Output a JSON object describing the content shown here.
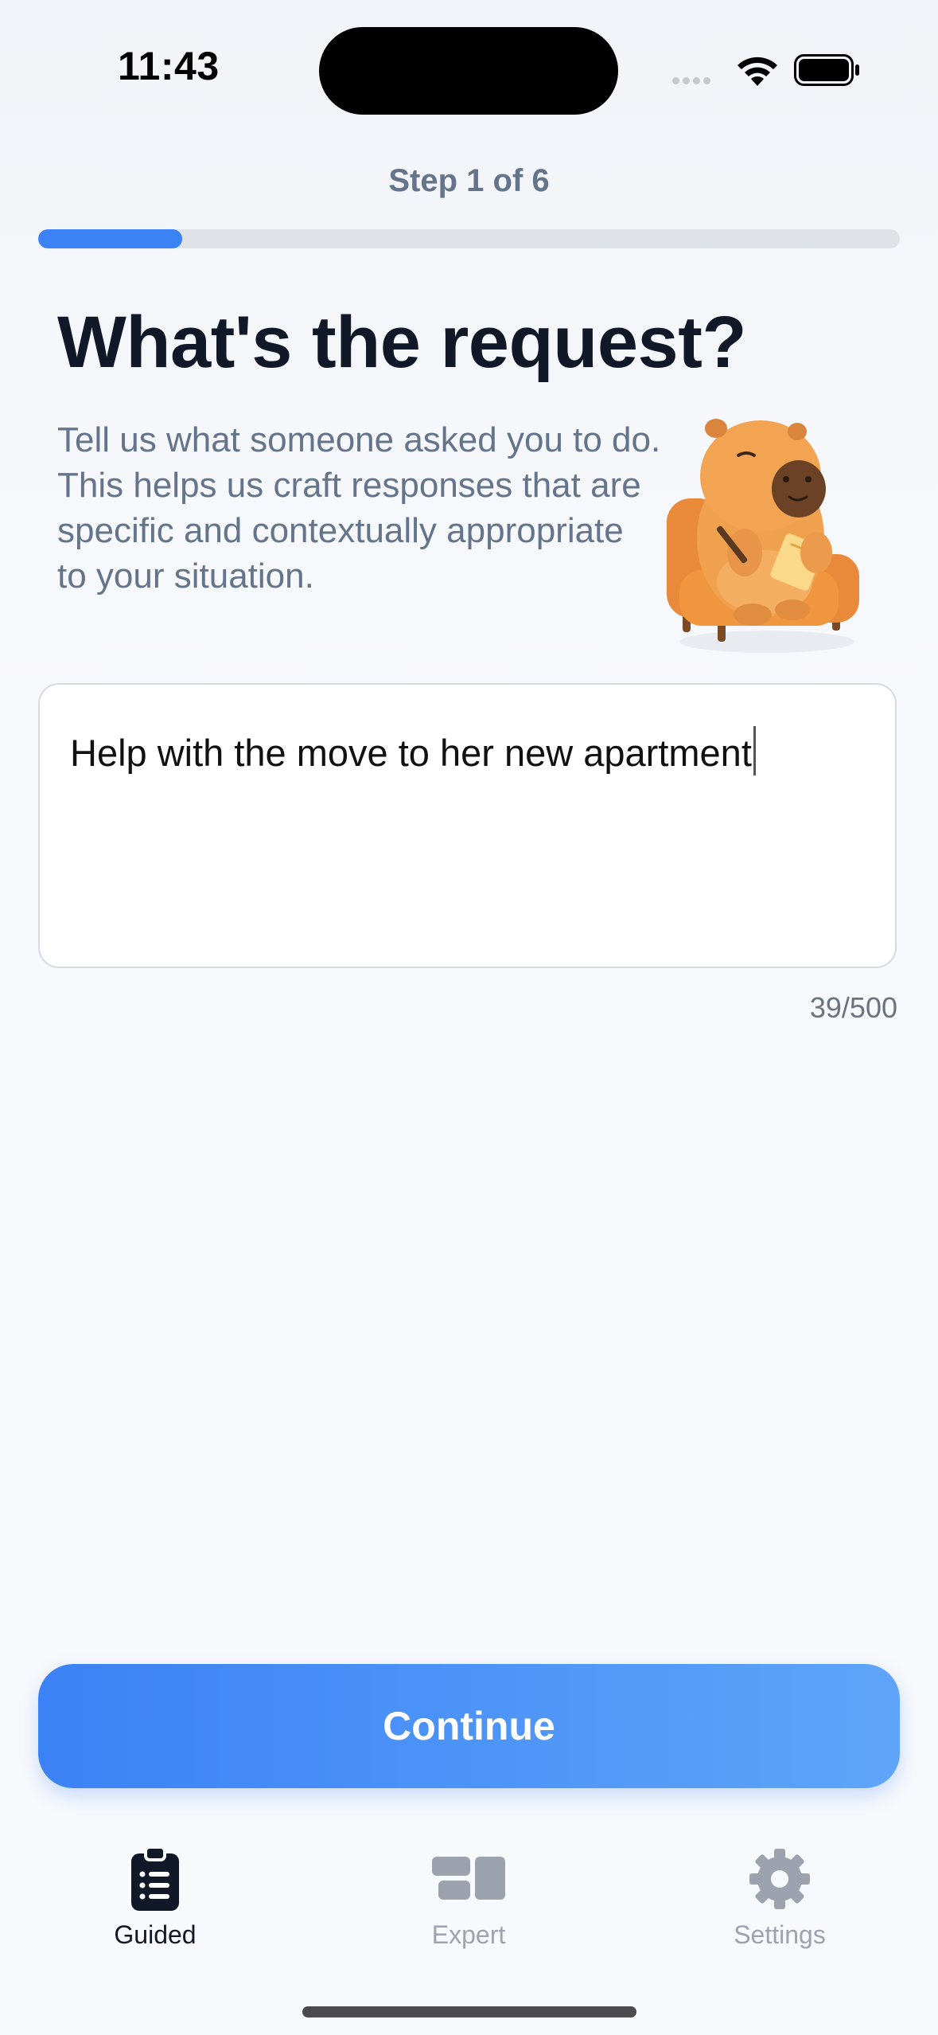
{
  "status_bar": {
    "time": "11:43"
  },
  "header": {
    "step_label": "Step 1 of 6",
    "progress_fraction": 0.1667
  },
  "main": {
    "title": "What's the request?",
    "description": "Tell us what someone asked you to do. This helps us craft responses that are specific and contextually appropriate to your situation.",
    "request_value": "Help with the move to her new apartment",
    "char_count": "39/500"
  },
  "actions": {
    "continue_label": "Continue"
  },
  "tab_bar": {
    "tabs": [
      {
        "label": "Guided",
        "icon": "clipboard-list-icon",
        "active": true
      },
      {
        "label": "Expert",
        "icon": "dashboard-icon",
        "active": false
      },
      {
        "label": "Settings",
        "icon": "gear-icon",
        "active": false
      }
    ]
  },
  "colors": {
    "accent": "#3b82f6",
    "title": "#111827",
    "muted": "#64748b",
    "mascot": "#e9954a"
  }
}
